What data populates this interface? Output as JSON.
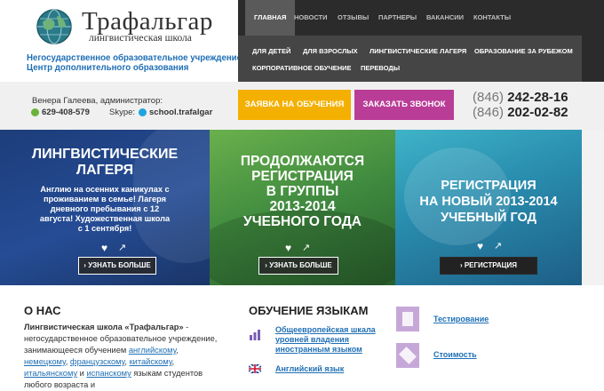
{
  "logo": {
    "title": "Трафальгар",
    "subtitle": "лингвистическая школа",
    "icon": "globe-icon"
  },
  "org": {
    "line1": "Негосударственное образовательное учреждение",
    "line2": "Центр дополнительного образования"
  },
  "nav": {
    "top": [
      "ГЛАВНАЯ",
      "НОВОСТИ",
      "ОТЗЫВЫ",
      "ПАРТНЕРЫ",
      "ВАКАНСИИ",
      "КОНТАКТЫ"
    ],
    "sub": [
      "ДЛЯ ДЕТЕЙ",
      "ДЛЯ ВЗРОСЛЫХ",
      "ЛИНГВИСТИЧЕСКИЕ ЛАГЕРЯ",
      "ОБРАЗОВАНИЕ ЗА РУБЕЖОМ",
      "КОРПОРАТИВНОЕ ОБУЧЕНИЕ",
      "ПЕРЕВОДЫ"
    ]
  },
  "contact": {
    "admin": "Венера Галеева, администратор:",
    "phone": "629-408-579",
    "skype_label": "Skype:",
    "skype_id": "school.trafalgar"
  },
  "buttons": {
    "apply": "ЗАЯВКА НА ОБУЧЕНИЯ",
    "call": "ЗАКАЗАТЬ ЗВОНОК"
  },
  "phones": [
    {
      "code": "(846)",
      "number": "242-28-16"
    },
    {
      "code": "(846)",
      "number": "202-02-82"
    }
  ],
  "panels": [
    {
      "title": [
        "ЛИНГВИСТИЧЕСКИЕ",
        "ЛАГЕРЯ"
      ],
      "text": [
        "Англию на осенних каникулах с",
        "проживанием в семье! Лагеря",
        "дневного пребывания с 12",
        "августа! Художественная школа",
        "с 1 сентября!"
      ],
      "button": "УЗНАТЬ БОЛЬШЕ"
    },
    {
      "title": [
        "ПРОДОЛЖАЮТСЯ",
        "РЕГИСТРАЦИЯ",
        "В ГРУППЫ",
        "2013-2014",
        "УЧЕБНОГО ГОДА"
      ],
      "button": "УЗНАТЬ БОЛЬШЕ"
    },
    {
      "title": [
        "РЕГИСТРАЦИЯ",
        "НА НОВЫЙ 2013-2014",
        "УЧЕБНЫЙ ГОД"
      ],
      "button": "РЕГИСТРАЦИЯ"
    }
  ],
  "about": {
    "title": "О НАС",
    "lead": "Лингвистическая школа «Трафальгар»",
    "text1": " - негосударственное образовательное учреждение, занимающееся обучением ",
    "links": [
      "английскому",
      "немецкому",
      "французскому",
      "китайскому",
      "итальянскому",
      "испанскому"
    ],
    "text2": " языкам студентов любого возраста и"
  },
  "languages": {
    "title": "ОБУЧЕНИЕ ЯЗЫКАМ",
    "items": [
      "Общеевропейская шкала уровней владения иностранным языком",
      "Английский язык"
    ]
  },
  "side_links": [
    "Тестирование",
    "Стоимость"
  ],
  "colors": {
    "accent_blue": "#1f6fb5",
    "yellow": "#f4b000",
    "purple": "#b93d97",
    "nav_dark": "#2b2b2b"
  }
}
